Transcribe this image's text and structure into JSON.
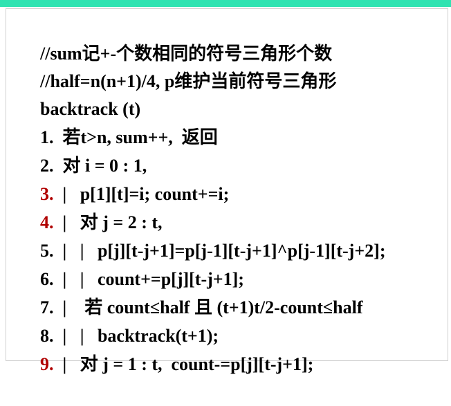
{
  "colors": {
    "top_bar": "#2fe3b1",
    "text": "#000000",
    "highlight_number": "#b00000"
  },
  "lines": [
    {
      "num": "",
      "text": "//sum记+-个数相同的符号三角形个数"
    },
    {
      "num": "",
      "text": "//half=n(n+1)/4, p维护当前符号三角形"
    },
    {
      "num": "",
      "text": "backtrack (t)"
    },
    {
      "num": "1.",
      "text": "  若t>n, sum++,  返回"
    },
    {
      "num": "2.",
      "text": "  对 i = 0 : 1,"
    },
    {
      "num": "3.",
      "text": "  |   p[1][t]=i; count+=i;"
    },
    {
      "num": "4.",
      "text": "  |   对 j = 2 : t,"
    },
    {
      "num": "5.",
      "text": "  |   |   p[j][t-j+1]=p[j-1][t-j+1]^p[j-1][t-j+2];"
    },
    {
      "num": "6.",
      "text": "  |   |   count+=p[j][t-j+1];"
    },
    {
      "num": "7.",
      "text": "  |    若 count≤half 且 (t+1)t/2-count≤half"
    },
    {
      "num": "8.",
      "text": "  |   |   backtrack(t+1);"
    },
    {
      "num": "9.",
      "text": "  |   对 j = 1 : t,  count-=p[j][t-j+1];"
    }
  ]
}
